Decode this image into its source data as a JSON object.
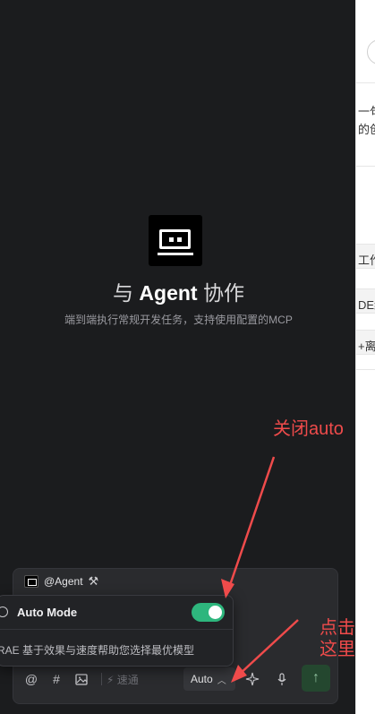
{
  "hero": {
    "title_prefix": "与 ",
    "title_bold": "Agent",
    "title_suffix": " 协作",
    "subtitle": "端到端执行常规开发任务，支持使用配置的MCP",
    "logo_icon": "robot-screen-icon"
  },
  "annotations": {
    "close_auto": "关闭auto",
    "click_here_line1": "点击",
    "click_here_line2": "这里",
    "color": "#ef4b4b"
  },
  "input": {
    "agent_tag": "@Agent",
    "agent_tools_icon": "tools-icon"
  },
  "popup": {
    "label": "Auto Mode",
    "enabled": true,
    "description": "RAE 基于效果与速度帮助您选择最优模型",
    "toggle_color": "#2eb67d"
  },
  "toolbar": {
    "at_symbol": "@",
    "hash_symbol": "#",
    "speed_label": "速通",
    "model_label": "Auto",
    "send_symbol": "↑"
  },
  "right_panel": {
    "fragments": [
      "一句",
      "的创",
      "工作",
      "DE编",
      "+离"
    ]
  }
}
